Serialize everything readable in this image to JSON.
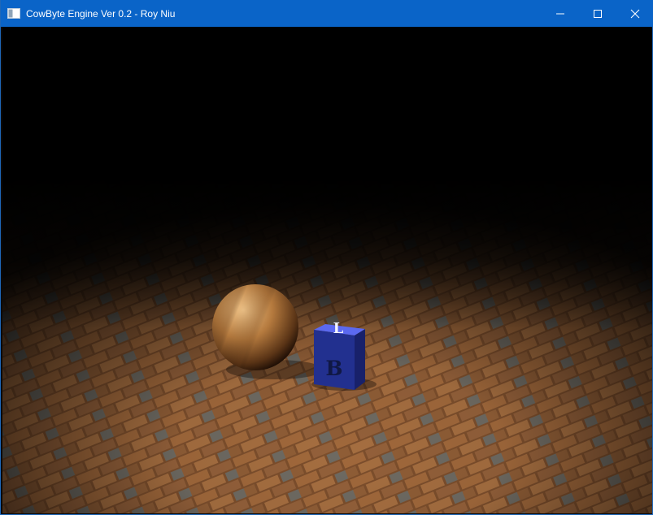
{
  "window": {
    "title": "CowByte Engine Ver 0.2 - Roy Niu",
    "controls": {
      "minimize_icon": "minimize-icon",
      "maximize_icon": "maximize-icon",
      "close_icon": "close-icon"
    }
  },
  "scene": {
    "objects": {
      "sphere": "wood-textured-sphere",
      "cube": "letter-block-cube",
      "floor": "brick-floor"
    },
    "cube_letters": {
      "top": "L",
      "front": "B"
    },
    "colors": {
      "titlebar": "#0a64c8",
      "cube": "#3a49d6",
      "wood": "#b57a3e",
      "brick": "#7a4c2a"
    }
  }
}
